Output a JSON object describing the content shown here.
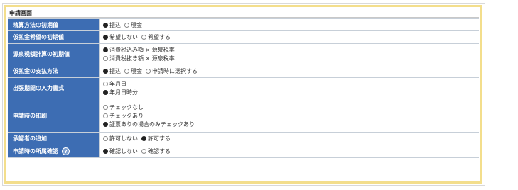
{
  "screen_title": "申請画面",
  "settings": [
    {
      "label": "精算方法の初期値",
      "options": [
        {
          "text": "振込",
          "selected": true,
          "newline": false
        },
        {
          "text": "現金",
          "selected": false,
          "newline": false
        }
      ]
    },
    {
      "label": "仮払金希望の初期値",
      "options": [
        {
          "text": "希望しない",
          "selected": true,
          "newline": false
        },
        {
          "text": "希望する",
          "selected": false,
          "newline": false
        }
      ]
    },
    {
      "label": "源泉税額計算の初期値",
      "options": [
        {
          "text": "消費税込み額 × 源泉税率",
          "selected": true,
          "newline": true
        },
        {
          "text": "消費税抜き額 × 源泉税率",
          "selected": false,
          "newline": true
        }
      ]
    },
    {
      "label": "仮払金の支払方法",
      "options": [
        {
          "text": "振込",
          "selected": true,
          "newline": false
        },
        {
          "text": "現金",
          "selected": false,
          "newline": false
        },
        {
          "text": "申請時に選択する",
          "selected": false,
          "newline": false
        }
      ]
    },
    {
      "label": "出張期間の入力書式",
      "options": [
        {
          "text": "年月日",
          "selected": false,
          "newline": true
        },
        {
          "text": "年月日時分",
          "selected": true,
          "newline": true
        }
      ]
    },
    {
      "label": "申請時の印刷",
      "options": [
        {
          "text": "チェックなし",
          "selected": false,
          "newline": true
        },
        {
          "text": "チェックあり",
          "selected": false,
          "newline": true
        },
        {
          "text": "証票ありの場合のみチェックあり",
          "selected": true,
          "newline": true
        }
      ]
    },
    {
      "label": "承認者の追加",
      "options": [
        {
          "text": "許可しない",
          "selected": false,
          "newline": false
        },
        {
          "text": "許可する",
          "selected": true,
          "newline": false
        }
      ]
    },
    {
      "label": "申請時の所属確認",
      "help_icon": "question-icon",
      "options": [
        {
          "text": "確認しない",
          "selected": true,
          "newline": false
        },
        {
          "text": "確認する",
          "selected": false,
          "newline": false
        }
      ]
    }
  ]
}
